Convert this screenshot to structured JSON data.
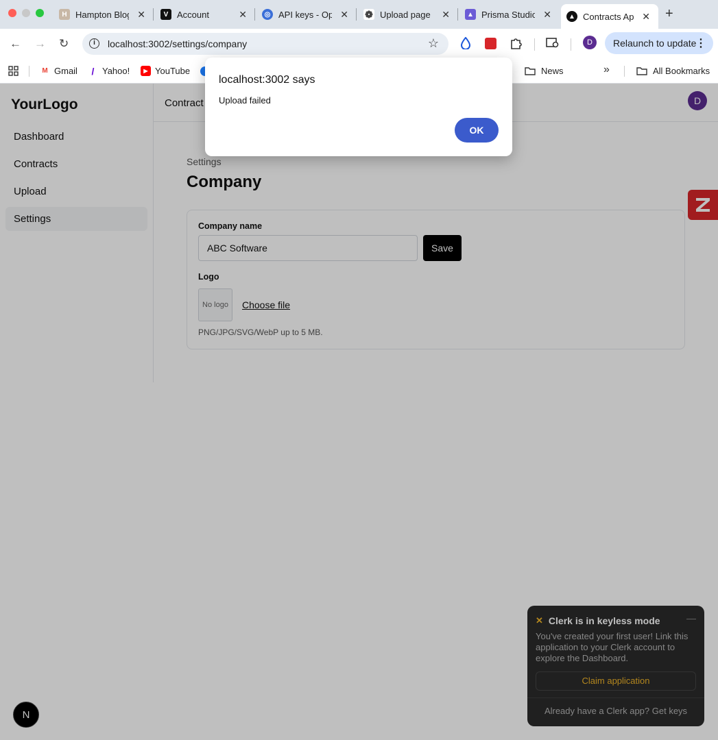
{
  "browser": {
    "tabs": [
      {
        "title": "Hampton Blog",
        "favicon": "H",
        "color": "#c8b8a6"
      },
      {
        "title": "Account",
        "favicon": "V",
        "color": "#111111"
      },
      {
        "title": "API keys - Op",
        "favicon": "◎",
        "color": "#3b6fd8"
      },
      {
        "title": "Upload page",
        "favicon": "❁",
        "color": "#444444"
      },
      {
        "title": "Prisma Studio",
        "favicon": "▲",
        "color": "#6b5bd6"
      },
      {
        "title": "Contracts Ap",
        "favicon": "▲",
        "color": "#111111"
      }
    ],
    "url": "localhost:3002/settings/company",
    "relaunch_label": "Relaunch to update",
    "profile_initial": "D",
    "bookmarks": [
      {
        "label": "Gmail",
        "icon": "M",
        "color": "#ea4335"
      },
      {
        "label": "Yahoo!",
        "icon": "/",
        "color": "#6001d2"
      },
      {
        "label": "YouTube",
        "icon": "▶",
        "color": "#ff0000"
      },
      {
        "label": "News",
        "icon": "folder-icon",
        "color": "#444444"
      }
    ],
    "all_bookmarks_label": "All Bookmarks"
  },
  "app": {
    "brand": "YourLogo",
    "nav": [
      "Dashboard",
      "Contracts",
      "Upload",
      "Settings"
    ],
    "topbar_crumb": "Contract",
    "avatar_initial": "D",
    "settings_label": "Settings",
    "page_title": "Company",
    "company_name_label": "Company name",
    "company_name_value": "ABC Software",
    "save_label": "Save",
    "logo_label": "Logo",
    "logo_placeholder": "No logo",
    "choose_file_label": "Choose file",
    "logo_hint": "PNG/JPG/SVG/WebP up to 5 MB."
  },
  "clerk": {
    "title": "Clerk is in keyless mode",
    "body": "You've created your first user! Link this application to your Clerk account to explore the Dashboard.",
    "claim_label": "Claim application",
    "keys_label": "Already have a Clerk app? Get keys"
  },
  "dialog": {
    "title": "localhost:3002 says",
    "message": "Upload failed",
    "ok_label": "OK"
  },
  "next_badge": "N",
  "colors": {
    "accent_button": "#3b5bcc",
    "avatar": "#5b2c91",
    "save_button": "#000000",
    "zapier": "#d7262a",
    "clerk_accent": "#f0b429"
  }
}
